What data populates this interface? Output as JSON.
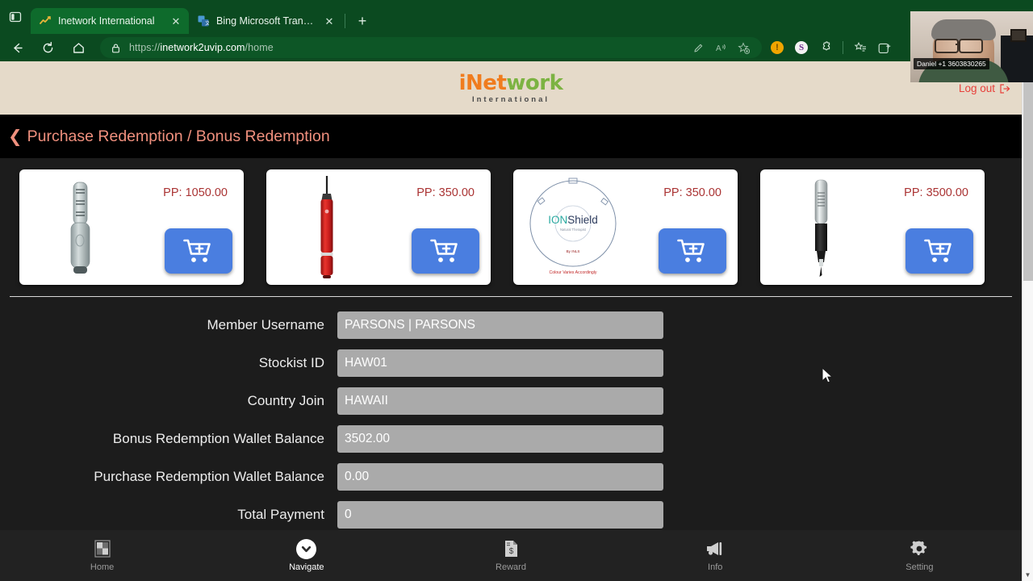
{
  "browser": {
    "tabs": [
      {
        "title": "Inetwork International",
        "favicon": "chart-line-icon",
        "active": true
      },
      {
        "title": "Bing Microsoft Translator",
        "favicon": "translator-icon",
        "active": false
      }
    ],
    "new_tab_label": "+",
    "tab_close_label": "✕",
    "address": {
      "scheme": "https://",
      "host": "inetwork2uvip.com",
      "path": "/home",
      "full": "https://inetwork2uvip.com/home",
      "lock_icon": "lock-icon"
    },
    "nav_buttons": [
      "back-icon",
      "refresh-icon",
      "home-icon"
    ],
    "omnibox_icons": [
      "edit-pen-icon",
      "read-aloud-icon",
      "add-favorite-icon"
    ],
    "toolbar_icons": [
      "alert-badge-icon",
      "shopping-savings-icon",
      "extensions-icon",
      "collections-icon",
      "browser-essentials-icon"
    ],
    "alert_badge_text": "!",
    "savings_badge_text": "S",
    "colors": {
      "chrome_green": "#0b4a20",
      "active_tab": "#0e6b2c",
      "omnibox": "#0d5626"
    }
  },
  "webcam": {
    "caller_label": "Daniel +1 3603830265"
  },
  "site_header": {
    "logo": {
      "i": "i",
      "net": "Net",
      "work": "work",
      "subtitle": "International"
    },
    "logout_label": "Log out",
    "logout_icon": "sign-out-icon",
    "background": "#e5dac9",
    "logout_color": "#e8403a"
  },
  "page_title": {
    "back_icon": "chevron-left-icon",
    "text": "Purchase Redemption / Bonus Redemption",
    "color": "#f0907e"
  },
  "products": [
    {
      "pp_label": "PP: 1050.00",
      "image": "silver-wand-device-image",
      "cart_icon": "cart-plus-icon",
      "cart_color": "#4a7ee0"
    },
    {
      "pp_label": "PP: 350.00",
      "image": "red-pen-device-image",
      "cart_icon": "cart-plus-icon",
      "cart_color": "#4a7ee0"
    },
    {
      "pp_label": "PP: 350.00",
      "image": "ionshield-disc-image",
      "cart_icon": "cart-plus-icon",
      "cart_color": "#4a7ee0"
    },
    {
      "pp_label": "PP: 3500.00",
      "image": "black-silver-wand-image",
      "cart_icon": "cart-plus-icon",
      "cart_color": "#4a7ee0"
    }
  ],
  "ionshield": {
    "ion": "ION",
    "shield": "Shield",
    "tagline": "Natural Therapist",
    "by": "By INLS",
    "footnote": "Colour Varies Accordingly"
  },
  "form": {
    "fields": [
      {
        "label": "Member Username",
        "value": "PARSONS | PARSONS"
      },
      {
        "label": "Stockist ID",
        "value": "HAW01"
      },
      {
        "label": "Country Join",
        "value": "HAWAII"
      },
      {
        "label": "Bonus Redemption Wallet Balance",
        "value": "3502.00"
      },
      {
        "label": "Purchase Redemption Wallet Balance",
        "value": "0.00"
      },
      {
        "label": "Total Payment",
        "value": "0"
      }
    ]
  },
  "bottom_nav": [
    {
      "label": "Home",
      "icon": "grid-home-icon",
      "active": false
    },
    {
      "label": "Navigate",
      "icon": "chevron-down-circle-icon",
      "active": true
    },
    {
      "label": "Reward",
      "icon": "dollar-document-icon",
      "active": false
    },
    {
      "label": "Info",
      "icon": "megaphone-icon",
      "active": false
    },
    {
      "label": "Setting",
      "icon": "gear-icon",
      "active": false
    }
  ],
  "scrollbar": {
    "down_arrow": "▼"
  }
}
